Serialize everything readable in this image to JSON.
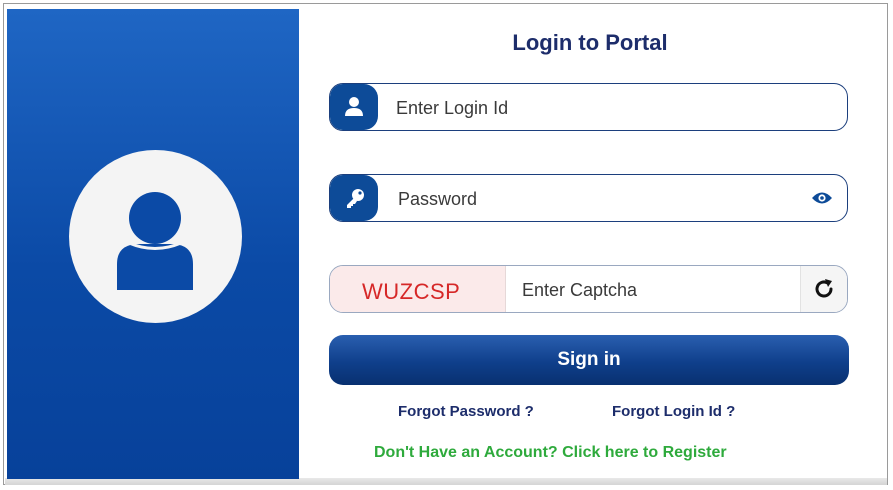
{
  "login": {
    "title": "Login to Portal",
    "login_id_placeholder": "Enter Login Id",
    "password_placeholder": "Password",
    "captcha_code": "WUZCSP",
    "captcha_placeholder": "Enter Captcha",
    "signin_label": "Sign in",
    "forgot_password": "Forgot Password ?",
    "forgot_login_id": "Forgot Login Id ?",
    "register_text": "Don't Have an Account? Click here to Register"
  },
  "icons": {
    "avatar": "user-avatar-icon",
    "user": "user-icon",
    "key": "key-icon",
    "eye": "eye-icon",
    "refresh": "refresh-icon"
  },
  "colors": {
    "panel_blue": "#0b4aa6",
    "title_navy": "#1d2d6b",
    "captcha_red": "#d62828",
    "register_green": "#2eaa3c"
  }
}
